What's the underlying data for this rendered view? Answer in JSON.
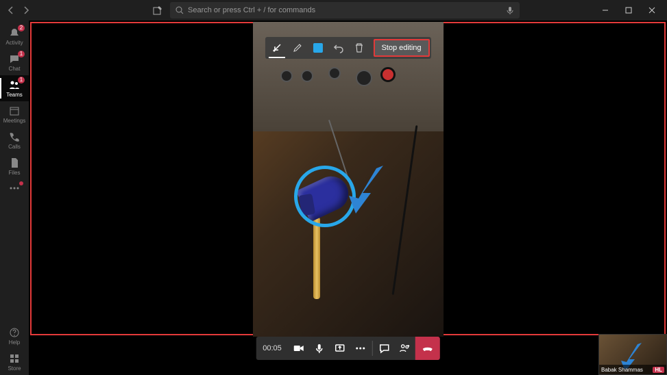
{
  "search": {
    "placeholder": "Search or press Ctrl + / for commands"
  },
  "rail": {
    "items": [
      {
        "label": "Activity",
        "badge": "2"
      },
      {
        "label": "Chat",
        "badge": "1"
      },
      {
        "label": "Teams",
        "badge": "1"
      },
      {
        "label": "Meetings",
        "badge": ""
      },
      {
        "label": "Calls",
        "badge": ""
      },
      {
        "label": "Files",
        "badge": ""
      }
    ],
    "help": {
      "label": "Help"
    },
    "store": {
      "label": "Store"
    }
  },
  "edit_toolbar": {
    "stop_label": "Stop editing",
    "swatch_color": "#28a7e9"
  },
  "call": {
    "time": "00:05"
  },
  "thumbnail": {
    "name": "Babak Shammas",
    "initials": "HL"
  }
}
